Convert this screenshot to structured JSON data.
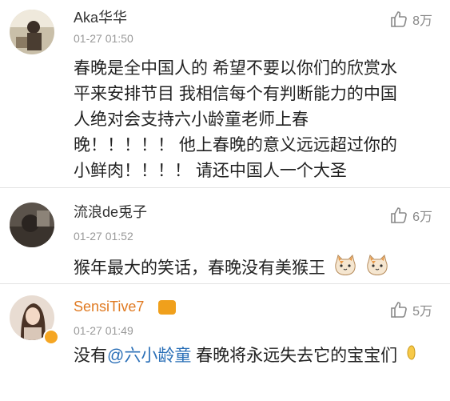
{
  "comments": [
    {
      "username": "Aka华华",
      "time": "01-27 01:50",
      "likes": "8万",
      "lines": [
        "春晚是全中国人的  希望不要以你们的欣赏水",
        "平来安排节目  我相信每个有判断能力的中国",
        "人绝对会支持六小龄童老师上春",
        "晚！！！！！  他上春晚的意义远远超过你的",
        "小鲜肉！！！！  请还中国人一个大圣"
      ]
    },
    {
      "username": "流浪de兎子",
      "time": "01-27 01:52",
      "likes": "6万",
      "text": "猴年最大的笑话，春晚没有美猴王"
    },
    {
      "username": "SensiTive7",
      "time": "01-27 01:49",
      "likes": "5万",
      "text_prefix": "没有",
      "mention": "@六小龄童",
      "text_suffix": " 春晚将永远失去它的宝宝们"
    }
  ],
  "icons": {
    "like": "thumbs-up-icon",
    "cat_emoji": "cat-face-icon",
    "verified": "verified-badge-icon"
  },
  "colors": {
    "username_vip": "#e07a22",
    "mention": "#2a6fb7",
    "time": "#999999"
  }
}
